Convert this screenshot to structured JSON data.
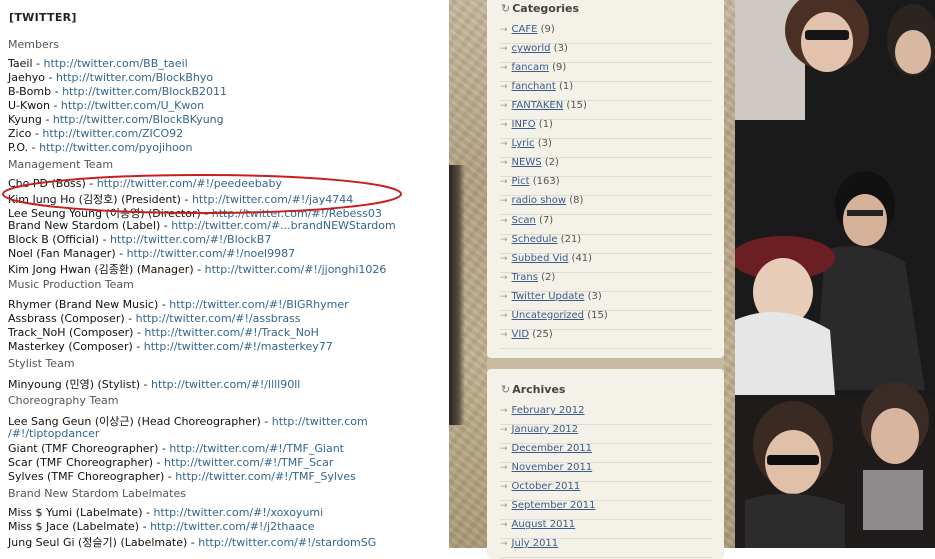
{
  "left": {
    "title": "[TWITTER]",
    "sections": [
      {
        "heading": "Members",
        "lines": [
          {
            "prefix": "Taeil - ",
            "url": "http://twitter.com/BB_taeil"
          },
          {
            "prefix": "Jaehyo - ",
            "url": "http://twitter.com/BlockBhyo"
          },
          {
            "prefix": "B-Bomb - ",
            "url": "http://twitter.com/BlockB2011"
          },
          {
            "prefix": "U-Kwon - ",
            "url": "http://twitter.com/U_Kwon"
          },
          {
            "prefix": "Kyung - ",
            "url": "http://twitter.com/BlockBKyung"
          },
          {
            "prefix": "Zico - ",
            "url": "http://twitter.com/ZICO92"
          },
          {
            "prefix": "P.O. - ",
            "url": "http://twitter.com/pyojihoon"
          }
        ]
      },
      {
        "heading": "Management Team",
        "lines": [
          {
            "prefix": "Cho PD (Boss) - ",
            "url": "http://twitter.com/#!/peedeebaby"
          },
          {
            "prefix": "Kim Jung Ho (김정호) (President) - ",
            "url": "http://twitter.com/#!/jay4744"
          },
          {
            "prefix": "Lee Seung Young (이승영) (Director) - ",
            "url": "http://twitter.com/#!/Rebess03"
          },
          {
            "prefix": "Brand New Stardom (Label) - ",
            "url": "http://twitter.com/#...brandNEWStardom"
          },
          {
            "prefix": "Block B (Official) - ",
            "url": "http://twitter.com/#!/BlockB7"
          },
          {
            "prefix": "Noel (Fan Manager) - ",
            "url": "http://twitter.com/#!/noel9987"
          },
          {
            "prefix": "Kim Jong Hwan (김종환) (Manager) - ",
            "url": "http://twitter.com/#!/jjonghi1026"
          }
        ]
      },
      {
        "heading": "Music Production Team",
        "lines": [
          {
            "prefix": "Rhymer (Brand New Music) - ",
            "url": "http://twitter.com/#!/BIGRhymer"
          },
          {
            "prefix": "Assbrass (Composer) - ",
            "url": "http://twitter.com/#!/assbrass"
          },
          {
            "prefix": "Track_NoH (Composer) - ",
            "url": "http://twitter.com/#!/Track_NoH"
          },
          {
            "prefix": "Masterkey (Composer) - ",
            "url": "http://twitter.com/#!/masterkey77"
          }
        ]
      },
      {
        "heading": "Stylist Team",
        "lines": [
          {
            "prefix": "Minyoung (민영) (Stylist) - ",
            "url": "http://twitter.com/#!/llll90ll"
          }
        ]
      },
      {
        "heading": "Choreography Team",
        "lines": [
          {
            "prefix": "Lee Sang Geun (이상근) (Head Choreographer) - ",
            "url": "http://twitter.com"
          },
          {
            "prefix": "",
            "url": "/#!/tiptopdancer"
          },
          {
            "prefix": "Giant (TMF Choreographer) - ",
            "url": "http://twitter.com/#!/TMF_Giant"
          },
          {
            "prefix": "Scar (TMF Choreographer) - ",
            "url": "http://twitter.com/#!/TMF_Scar"
          },
          {
            "prefix": "Sylves (TMF Choreographer) - ",
            "url": "http://twitter.com/#!/TMF_Sylves"
          }
        ]
      },
      {
        "heading": "Brand New Stardom Labelmates",
        "lines": [
          {
            "prefix": "Miss $ Yumi (Labelmate) - ",
            "url": "http://twitter.com/#!/xoxoyumi"
          },
          {
            "prefix": "Miss $ Jace (Labelmate) - ",
            "url": "http://twitter.com/#!/j2thaace"
          },
          {
            "prefix": "Jung Seul Gi (정슬기) (Labelmate) - ",
            "url": "http://twitter.com/#!/stardomSG"
          }
        ]
      }
    ]
  },
  "categories": {
    "heading": "Categories",
    "items": [
      {
        "label": "CAFE",
        "count": "(9)"
      },
      {
        "label": "cyworld",
        "count": "(3)"
      },
      {
        "label": "fancam",
        "count": "(9)"
      },
      {
        "label": "fanchant",
        "count": "(1)"
      },
      {
        "label": "FANTAKEN",
        "count": "(15)"
      },
      {
        "label": "INFO",
        "count": "(1)"
      },
      {
        "label": "Lyric",
        "count": "(3)"
      },
      {
        "label": "NEWS",
        "count": "(2)"
      },
      {
        "label": "Pict",
        "count": "(163)"
      },
      {
        "label": "radio show",
        "count": "(8)"
      },
      {
        "label": "Scan",
        "count": "(7)"
      },
      {
        "label": "Schedule",
        "count": "(21)"
      },
      {
        "label": "Subbed Vid",
        "count": "(41)"
      },
      {
        "label": "Trans",
        "count": "(2)"
      },
      {
        "label": "Twitter Update",
        "count": "(3)"
      },
      {
        "label": "Uncategorized",
        "count": "(15)"
      },
      {
        "label": "VID",
        "count": "(25)"
      }
    ]
  },
  "archives": {
    "heading": "Archives",
    "items": [
      {
        "label": "February 2012"
      },
      {
        "label": "January 2012"
      },
      {
        "label": "December 2011"
      },
      {
        "label": "November 2011"
      },
      {
        "label": "October 2011"
      },
      {
        "label": "September 2011"
      },
      {
        "label": "August 2011"
      },
      {
        "label": "July 2011"
      }
    ]
  },
  "theme": {
    "link_color": "#34668f",
    "highlight_oval_color": "#c81e1e",
    "sidebar_bg": "#f3f1e8"
  }
}
